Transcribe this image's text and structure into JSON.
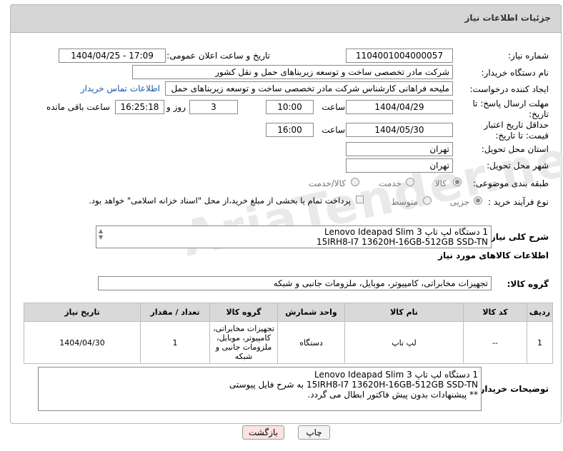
{
  "page_title": "جزئیات اطلاعات نیاز",
  "fields": {
    "need_number_label": "شماره نیاز:",
    "need_number": "1104001004000057",
    "announce_label": "تاریخ و ساعت اعلان عمومی:",
    "announce_value": "1404/04/25 - 17:09",
    "buyer_org_label": "نام دستگاه خریدار:",
    "buyer_org": "شرکت مادر تخصصی ساخت و توسعه زیربناهای حمل و نقل کشور",
    "creator_label": "ایجاد کننده درخواست:",
    "creator": "ملیحه فراهانی کارشناس شرکت مادر تخصصی ساخت و توسعه زیربناهای حمل",
    "contact_link": "اطلاعات تماس خریدار",
    "deadline_label": "مهلت ارسال پاسخ: تا تاریخ:",
    "deadline_date": "1404/04/29",
    "time_label": "ساعت",
    "deadline_time": "10:00",
    "days_value": "3",
    "days_label": "روز و",
    "remaining_time": "16:25:18",
    "remaining_label": "ساعت باقی مانده",
    "validity_label": "حداقل تاریخ اعتبار قیمت: تا تاریخ:",
    "validity_date": "1404/05/30",
    "validity_time": "16:00",
    "province_label": "استان محل تحویل:",
    "province": "تهران",
    "city_label": "شهر محل تحویل:",
    "city": "تهران",
    "category_label": "طبقه بندی موضوعی:",
    "category_options": [
      "کالا",
      "خدمت",
      "کالا/خدمت"
    ],
    "process_label": "نوع فرآیند خرید :",
    "process_options": [
      "جزیی",
      "متوسط"
    ],
    "payment_note": "پرداخت تمام یا بخشی از مبلغ خرید،از محل \"اسناد خزانه اسلامی\" خواهد بود."
  },
  "general_desc_label": "شرح کلی نیاز:",
  "general_desc_lines": [
    "1 دستگاه لپ تاپ Lenovo Ideapad Slim 3",
    "15IRH8-I7 13620H-16GB-512GB SSD-TN"
  ],
  "goods_info_title": "اطلاعات کالاهای مورد نیاز",
  "goods_group_label": "گروه کالا:",
  "goods_group": "تجهیزات مخابراتی، کامپیوتر، موبایل، ملزومات جانبی و شبکه",
  "table": {
    "headers": [
      "ردیف",
      "کد کالا",
      "نام کالا",
      "واحد شمارش",
      "گروه کالا",
      "تعداد / مقدار",
      "تاریخ نیاز"
    ],
    "rows": [
      [
        "1",
        "--",
        "لپ تاپ",
        "دستگاه",
        "تجهیزات مخابراتی، کامپیوتر، موبایل، ملزومات جانبی و شبکه",
        "1",
        "1404/04/30"
      ]
    ]
  },
  "buyer_desc_label": "توضیحات خریدار:",
  "buyer_desc_lines": [
    "1 دستگاه لپ تاپ Lenovo Ideapad Slim 3",
    "15IRH8-I7 13620H-16GB-512GB SSD-TN به شرح فایل پیوستی",
    "** پیشنهادات بدون پیش فاکتور ابطال می گردد."
  ],
  "buttons": {
    "print": "چاپ",
    "back": "بازگشت"
  },
  "watermark": "AriaTender.neT",
  "colors": {
    "header_bg": "#d6d6d6",
    "link": "#1a5aa8",
    "back_button_bg": "#fbe3e3"
  }
}
